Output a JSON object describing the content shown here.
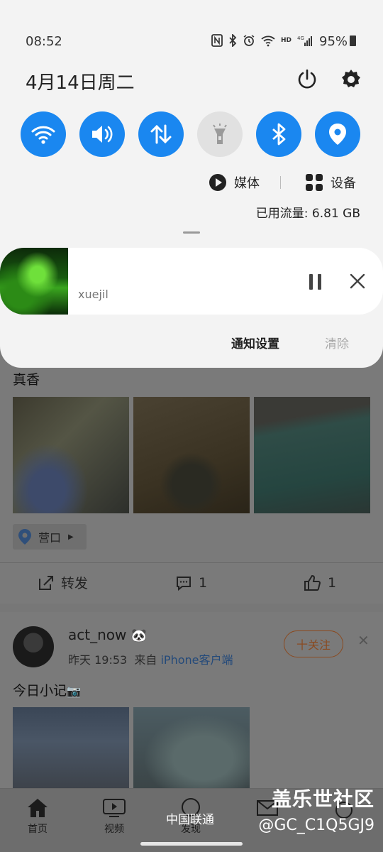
{
  "status_bar": {
    "time": "08:52",
    "battery": "95%"
  },
  "quick_panel": {
    "date": "4月14日周二",
    "tiles": [
      {
        "name": "wifi",
        "on": true
      },
      {
        "name": "sound",
        "on": true
      },
      {
        "name": "mobile-data",
        "on": true
      },
      {
        "name": "flashlight",
        "on": false
      },
      {
        "name": "bluetooth",
        "on": true
      },
      {
        "name": "location",
        "on": true
      }
    ],
    "media_label": "媒体",
    "devices_label": "设备",
    "data_usage": "已用流量: 6.81 GB",
    "accent": "#1a87f0"
  },
  "media_notification": {
    "artist": "xuejil"
  },
  "notification_actions": {
    "settings": "通知设置",
    "clear": "清除"
  },
  "feed": {
    "post1": {
      "text": "真香",
      "location": "营口",
      "repost": "转发",
      "comments": "1",
      "likes": "1"
    },
    "post2": {
      "username": "act_now",
      "time": "昨天 19:53",
      "from": "来自",
      "source": "iPhone客户端",
      "follow": "十关注",
      "text": "今日小记"
    }
  },
  "bottom_nav": {
    "home": "首页",
    "video": "视频",
    "discover": "发现"
  },
  "carrier": "中国联通",
  "watermark": {
    "line1": "盖乐世社区",
    "line2": "@GC_C1Q5GJ9"
  }
}
